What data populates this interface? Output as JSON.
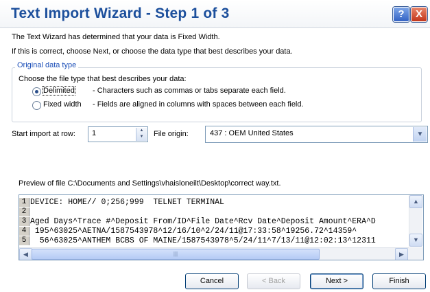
{
  "window": {
    "title": "Text Import Wizard - Step 1 of 3",
    "help_glyph": "?",
    "close_glyph": "X"
  },
  "intro": {
    "line1": "The Text Wizard has determined that your data is Fixed Width.",
    "line2": "If this is correct, choose Next, or choose the data type that best describes your data."
  },
  "data_type": {
    "legend": "Original data type",
    "prompt": "Choose the file type that best describes your data:",
    "options": [
      {
        "label": "Delimited",
        "description": "- Characters such as commas or tabs separate each field.",
        "selected": true
      },
      {
        "label": "Fixed width",
        "description": "- Fields are aligned in columns with spaces between each field.",
        "selected": false
      }
    ]
  },
  "import": {
    "start_row_label": "Start import at row:",
    "start_row_value": "1",
    "file_origin_label": "File origin:",
    "file_origin_value": "437 : OEM United States"
  },
  "preview": {
    "label": "Preview of file C:\\Documents and Settings\\vhaisloneilt\\Desktop\\correct way.txt.",
    "rows": [
      {
        "num": "1",
        "text": "DEVICE: HOME// 0;256;999  TELNET TERMINAL"
      },
      {
        "num": "2",
        "text": ""
      },
      {
        "num": "3",
        "text": "Aged Days^Trace #^Deposit From/ID^File Date^Rcv Date^Deposit Amount^ERA^D"
      },
      {
        "num": "4",
        "text": " 195^63025^AETNA/1587543978^12/16/10^2/24/11@17:33:58^19256.72^14359^"
      },
      {
        "num": "5",
        "text": "  56^63025^ANTHEM BCBS OF MAINE/1587543978^5/24/11^7/13/11@12:02:13^12311"
      }
    ]
  },
  "buttons": {
    "cancel": "Cancel",
    "back": "< Back",
    "next": "Next >",
    "finish": "Finish"
  },
  "icons": {
    "spin_up": "▲",
    "spin_down": "▼",
    "combo_arrow": "▼",
    "scroll_up": "▲",
    "scroll_down": "▼",
    "scroll_left": "◀",
    "scroll_right": "▶",
    "grip": "|||"
  }
}
